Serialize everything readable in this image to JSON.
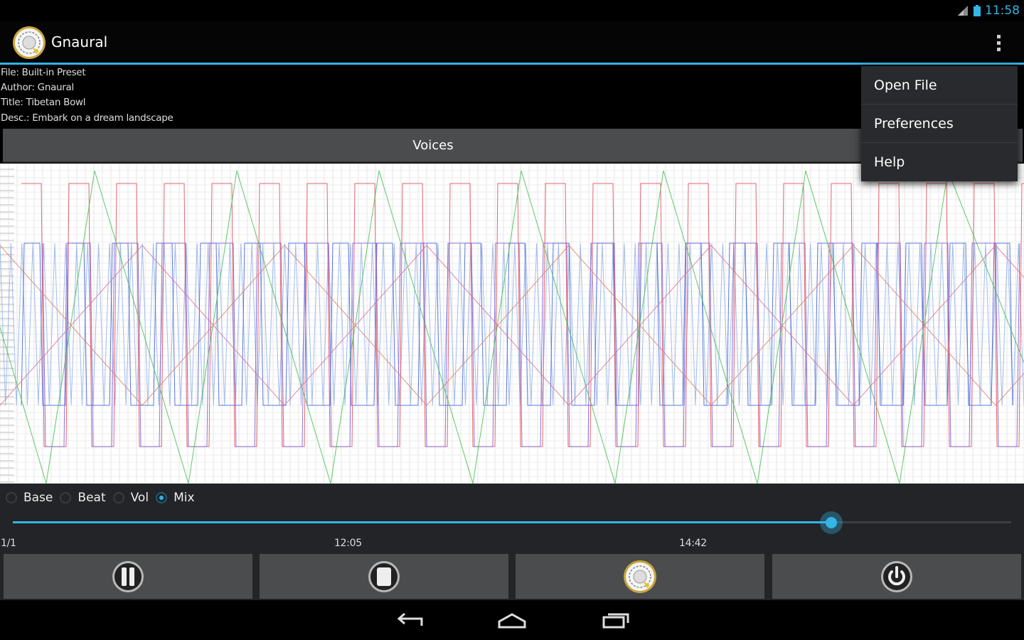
{
  "status_bar": {
    "time": "11:58"
  },
  "action_bar": {
    "title": "Gnaural"
  },
  "info": {
    "file": "File: Built-in Preset",
    "author": "Author: Gnaural",
    "title": "Title: Tibetan Bowl",
    "desc": "Desc.: Embark on a dream landscape"
  },
  "voices_button": {
    "label": "Voices"
  },
  "graph_view": {
    "colors": {
      "red": "#e24a5a",
      "blue": "#3d5fd8",
      "green": "#3fbf4f",
      "pink": "#e07090",
      "lightblue": "#8fb0e8"
    }
  },
  "radio_group": {
    "options": [
      {
        "label": "Base",
        "checked": false
      },
      {
        "label": "Beat",
        "checked": false
      },
      {
        "label": "Vol",
        "checked": false
      },
      {
        "label": "Mix",
        "checked": true
      }
    ]
  },
  "seek": {
    "progress": 0.82,
    "position_label": "1/1",
    "elapsed": "12:05",
    "total": "14:42"
  },
  "bottom_buttons": [
    "pause-icon",
    "stop-icon",
    "gnaural-logo-icon",
    "power-icon"
  ],
  "overflow_menu": {
    "items": [
      "Open File",
      "Preferences",
      "Help"
    ]
  },
  "accent_color": "#33b5e5"
}
